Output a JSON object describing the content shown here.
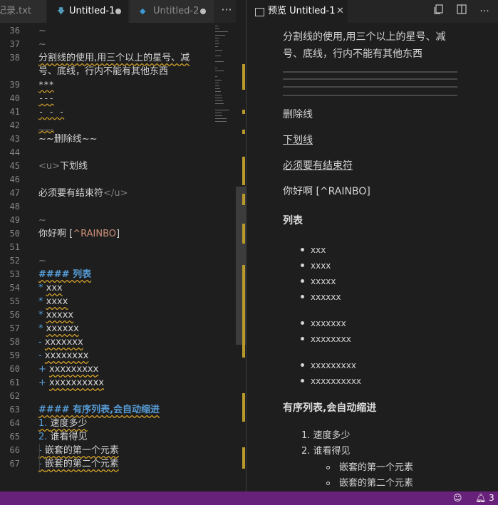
{
  "left_tabs": [
    {
      "label": "记录.txt"
    },
    {
      "label": "Untitled-1",
      "icon": "markdown-icon"
    },
    {
      "label": "Untitled-2",
      "icon": "vscode-icon"
    }
  ],
  "more_label": "···",
  "editor_lines": [
    {
      "n": "36",
      "segments": [
        {
          "t": "~",
          "c": "gray"
        }
      ]
    },
    {
      "n": "37",
      "segments": [
        {
          "t": "~",
          "c": "gray"
        }
      ]
    },
    {
      "n": "38",
      "segments": [
        {
          "t": "分割线的使用,用三个以上的星号、减",
          "c": ""
        }
      ]
    },
    {
      "n": "",
      "segments": [
        {
          "t": "号、底线，行内不能有其他东西",
          "c": ""
        }
      ]
    },
    {
      "n": "39",
      "segments": [
        {
          "t": "***",
          "c": "mono"
        }
      ]
    },
    {
      "n": "40",
      "segments": [
        {
          "t": "---",
          "c": "mono"
        }
      ]
    },
    {
      "n": "41",
      "segments": [
        {
          "t": "- - -",
          "c": "mono"
        }
      ]
    },
    {
      "n": "42",
      "segments": [
        {
          "t": "___",
          "c": "mono"
        }
      ]
    },
    {
      "n": "43",
      "segments": [
        {
          "t": "~~删除线~~",
          "c": ""
        }
      ]
    },
    {
      "n": "44",
      "segments": []
    },
    {
      "n": "45",
      "segments": [
        {
          "t": "<u>",
          "c": "gray"
        },
        {
          "t": "下划线",
          "c": ""
        }
      ]
    },
    {
      "n": "46",
      "segments": []
    },
    {
      "n": "47",
      "segments": [
        {
          "t": "必须要有结束符",
          "c": ""
        },
        {
          "t": "</u>",
          "c": "gray"
        }
      ]
    },
    {
      "n": "48",
      "segments": []
    },
    {
      "n": "49",
      "segments": [
        {
          "t": "~",
          "c": "gray"
        }
      ]
    },
    {
      "n": "50",
      "segments": [
        {
          "t": "你好啊 [",
          "c": ""
        },
        {
          "t": "^RAINBO",
          "c": "str"
        },
        {
          "t": "]",
          "c": ""
        }
      ]
    },
    {
      "n": "51",
      "segments": []
    },
    {
      "n": "52",
      "segments": [
        {
          "t": "~",
          "c": "gray"
        }
      ]
    },
    {
      "n": "53",
      "segments": [
        {
          "t": "#### 列表",
          "c": "bold"
        }
      ]
    },
    {
      "n": "54",
      "segments": [
        {
          "t": "* ",
          "c": "blue"
        },
        {
          "t": "xxx",
          "c": ""
        }
      ]
    },
    {
      "n": "55",
      "segments": [
        {
          "t": "* ",
          "c": "blue"
        },
        {
          "t": "xxxx",
          "c": ""
        }
      ]
    },
    {
      "n": "56",
      "segments": [
        {
          "t": "* ",
          "c": "blue"
        },
        {
          "t": "xxxxx",
          "c": ""
        }
      ]
    },
    {
      "n": "57",
      "segments": [
        {
          "t": "* ",
          "c": "blue"
        },
        {
          "t": "xxxxxx",
          "c": ""
        }
      ]
    },
    {
      "n": "58",
      "segments": [
        {
          "t": "- ",
          "c": "blue"
        },
        {
          "t": "xxxxxxx",
          "c": ""
        }
      ]
    },
    {
      "n": "59",
      "segments": [
        {
          "t": "- ",
          "c": "blue"
        },
        {
          "t": "xxxxxxxx",
          "c": ""
        }
      ]
    },
    {
      "n": "60",
      "segments": [
        {
          "t": "+ ",
          "c": "blue"
        },
        {
          "t": "xxxxxxxxx",
          "c": ""
        }
      ]
    },
    {
      "n": "61",
      "segments": [
        {
          "t": "+ ",
          "c": "blue"
        },
        {
          "t": "xxxxxxxxxx",
          "c": ""
        }
      ]
    },
    {
      "n": "62",
      "segments": []
    },
    {
      "n": "63",
      "segments": [
        {
          "t": "#### 有序列表,会自动缩进",
          "c": "bold"
        }
      ]
    },
    {
      "n": "64",
      "segments": [
        {
          "t": "1. ",
          "c": "blue"
        },
        {
          "t": "速度多少",
          "c": ""
        }
      ]
    },
    {
      "n": "65",
      "segments": [
        {
          "t": "2. ",
          "c": "blue"
        },
        {
          "t": "谁看得见",
          "c": ""
        }
      ]
    },
    {
      "n": "66",
      "segments": [
        {
          "t": "    - ",
          "c": "blue"
        },
        {
          "t": "嵌套的第一个元素",
          "c": ""
        }
      ]
    },
    {
      "n": "67",
      "segments": [
        {
          "t": "    - ",
          "c": "blue"
        },
        {
          "t": "嵌套的第二个元素",
          "c": ""
        }
      ]
    }
  ],
  "preview_tab": {
    "label": "预览 Untitled-1",
    "close": "✕"
  },
  "preview": {
    "intro": "分割线的使用,用三个以上的星号、减",
    "intro2": "号、底线，行内不能有其他东西",
    "strike": "删除线",
    "underline": "下划线",
    "underline2": "必须要有结束符",
    "footnote": "你好啊 [^RAINBO]",
    "list_heading": "列表",
    "list_items": [
      "xxx",
      "xxxx",
      "xxxxx",
      "xxxxxx",
      "xxxxxxx",
      "xxxxxxxx",
      "xxxxxxxxx",
      "xxxxxxxxxx"
    ],
    "ol_heading": "有序列表,会自动缩进",
    "ol_items": [
      "1. 速度多少",
      "2. 谁看得见"
    ],
    "nested_items": [
      "嵌套的第一个元素",
      "嵌套的第二个元素"
    ]
  },
  "status": {
    "notifications": "3"
  },
  "colors": {
    "statusbar": "#68217a",
    "squiggle": "#d1a12a",
    "keyword": "#569cd6"
  }
}
